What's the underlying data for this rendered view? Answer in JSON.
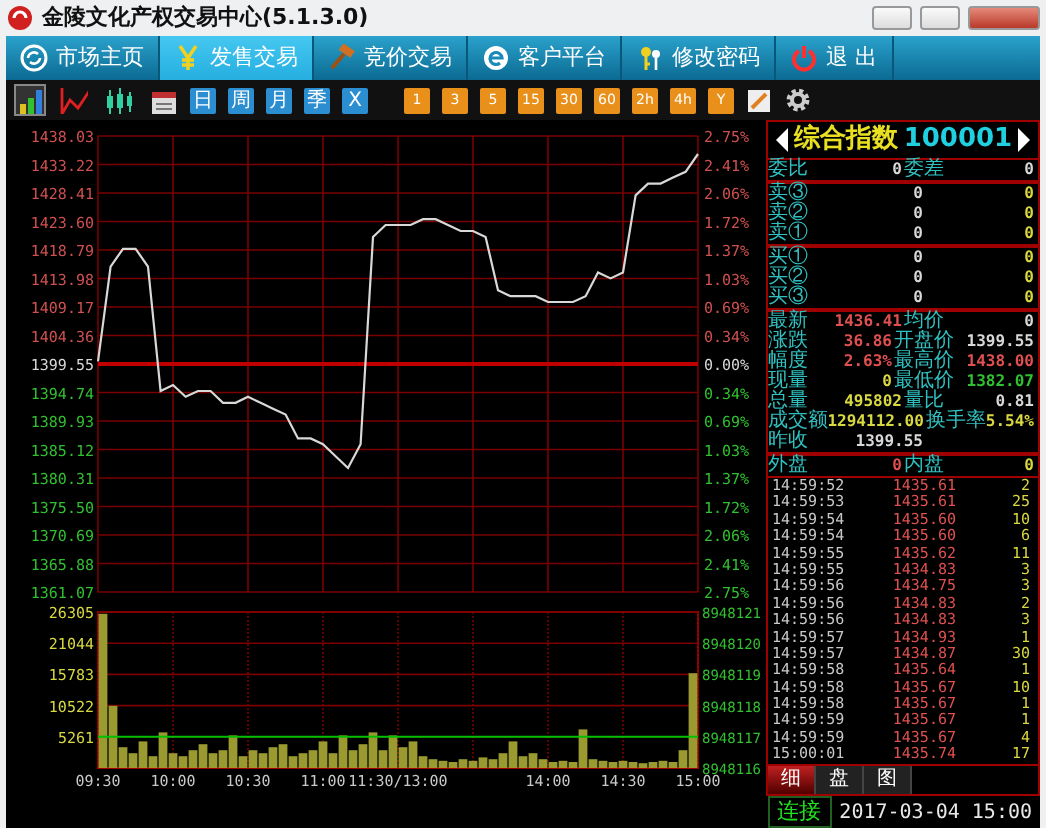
{
  "window": {
    "title": "金陵文化产权交易中心(5.1.3.0)"
  },
  "menu": [
    {
      "label": "市场主页",
      "selected": false
    },
    {
      "label": "发售交易",
      "selected": true
    },
    {
      "label": "竞价交易",
      "selected": false
    },
    {
      "label": "客户平台",
      "selected": false
    },
    {
      "label": "修改密码",
      "selected": false
    },
    {
      "label": "退 出",
      "selected": false
    }
  ],
  "toolbar": {
    "chart_tools": [
      {
        "selected": true
      },
      {
        "selected": false
      },
      {
        "selected": false
      },
      {
        "selected": false
      }
    ],
    "period_buttons": [
      {
        "label": "日"
      },
      {
        "label": "周"
      },
      {
        "label": "月"
      },
      {
        "label": "季"
      },
      {
        "label": "X"
      }
    ],
    "minute_buttons": [
      {
        "label": "1"
      },
      {
        "label": "3"
      },
      {
        "label": "5"
      },
      {
        "label": "15"
      },
      {
        "label": "30"
      },
      {
        "label": "60"
      },
      {
        "label": "2h"
      },
      {
        "label": "4h"
      },
      {
        "label": "Y"
      }
    ]
  },
  "price_chart": {
    "chart_data": {
      "type": "line",
      "grid": true,
      "ylim": [
        1361.07,
        1438.03
      ],
      "yticks": [
        {
          "value": 1438.03,
          "label": "1438.03"
        },
        {
          "value": 1433.22,
          "label": "1433.22"
        },
        {
          "value": 1428.41,
          "label": "1428.41"
        },
        {
          "value": 1423.6,
          "label": "1423.60"
        },
        {
          "value": 1418.79,
          "label": "1418.79"
        },
        {
          "value": 1413.98,
          "label": "1413.98"
        },
        {
          "value": 1409.17,
          "label": "1409.17"
        },
        {
          "value": 1404.36,
          "label": "1404.36"
        },
        {
          "value": 1399.55,
          "label": "1399.55"
        },
        {
          "value": 1394.74,
          "label": "1394.74"
        },
        {
          "value": 1389.93,
          "label": "1389.93"
        },
        {
          "value": 1385.12,
          "label": "1385.12"
        },
        {
          "value": 1380.31,
          "label": "1380.31"
        },
        {
          "value": 1375.5,
          "label": "1375.50"
        },
        {
          "value": 1370.69,
          "label": "1370.69"
        },
        {
          "value": 1365.88,
          "label": "1365.88"
        },
        {
          "value": 1361.07,
          "label": "1361.07"
        }
      ],
      "ref_lines": [
        {
          "axis": "y",
          "value": 1399.55,
          "color": "#c00000"
        }
      ],
      "categories": [
        null,
        null,
        null,
        null,
        null,
        null,
        null,
        null,
        null,
        null,
        null,
        null,
        null,
        null,
        null,
        null,
        null,
        null,
        null,
        null,
        null,
        null,
        null,
        null,
        null,
        null,
        null,
        null,
        null,
        null,
        null,
        null,
        null,
        null,
        null,
        null,
        null,
        null,
        null,
        null,
        null,
        null,
        null,
        null,
        null,
        null,
        null,
        null,
        null
      ],
      "series": [
        {
          "color": "#d8d8d8",
          "values": [
            1400,
            1416,
            1419,
            1419,
            1416,
            1395,
            1396,
            1394,
            1395,
            1395,
            1393,
            1393,
            1394,
            1393,
            1392,
            1391,
            1387,
            1387,
            1386,
            1384,
            1382,
            1386,
            1421,
            1423,
            1423,
            1423,
            1424,
            1424,
            1423,
            1422,
            1422,
            1421,
            1412,
            1411,
            1411,
            1411,
            1410,
            1410,
            1410,
            1411,
            1415,
            1414,
            1415,
            1428,
            1430,
            1430,
            1431,
            1432,
            1435
          ]
        }
      ]
    },
    "right_labels": [
      "2.75%",
      "2.41%",
      "2.06%",
      "1.72%",
      "1.37%",
      "1.03%",
      "0.69%",
      "0.34%",
      "0.00%",
      "0.34%",
      "0.69%",
      "1.03%",
      "1.37%",
      "1.72%",
      "2.06%",
      "2.41%",
      "2.75%"
    ]
  },
  "volume_chart": {
    "chart_data": {
      "type": "bar",
      "grid": true,
      "ylim": [
        0,
        26305
      ],
      "yticks": [
        {
          "value": 26305,
          "label": "26305"
        },
        {
          "value": 21044,
          "label": "21044"
        },
        {
          "value": 15783,
          "label": "15783"
        },
        {
          "value": 10522,
          "label": "10522"
        },
        {
          "value": 5261,
          "label": "5261"
        }
      ],
      "ref_lines": [
        {
          "axis": "y",
          "value": 5261,
          "color": "#00c000"
        }
      ],
      "categories": [
        null,
        null,
        null,
        null,
        null,
        null,
        null,
        null,
        null,
        null,
        null,
        null,
        null,
        null,
        null,
        null,
        null,
        null,
        null,
        null,
        null,
        null,
        null,
        null,
        null,
        null,
        null,
        null,
        null,
        null,
        null,
        null,
        null,
        null,
        null,
        null,
        null,
        null,
        null,
        null,
        null,
        null,
        null,
        null,
        null,
        null,
        null,
        null,
        null,
        null,
        null,
        null,
        null,
        null,
        null,
        null,
        null,
        null,
        null,
        null
      ],
      "series": [
        {
          "color": "#9a9a30",
          "values": [
            26000,
            10500,
            3500,
            2500,
            4500,
            2000,
            6000,
            2500,
            2000,
            3000,
            4000,
            2500,
            3000,
            5500,
            2000,
            3000,
            2500,
            3500,
            4000,
            2000,
            2500,
            3000,
            4500,
            2500,
            5500,
            3000,
            4000,
            6000,
            3000,
            5500,
            3500,
            4500,
            2000,
            1500,
            1200,
            1000,
            1500,
            1200,
            1800,
            1500,
            2500,
            4500,
            2000,
            2500,
            1500,
            1000,
            1200,
            1000,
            6500,
            1500,
            1200,
            1000,
            1200,
            1000,
            800,
            1000,
            1200,
            1000,
            3000,
            16000
          ]
        }
      ]
    },
    "right_labels": [
      "8948121",
      "8948120",
      "8948119",
      "8948118",
      "8948117",
      "8948116"
    ],
    "time_labels": [
      "09:30",
      "10:00",
      "10:30",
      "11:00",
      "11:30/13:00",
      "14:00",
      "14:30",
      "15:00"
    ]
  },
  "quote": {
    "name": "综合指数",
    "code": "100001",
    "blocks": [
      [
        {
          "cells": [
            {
              "label": "委比",
              "value": "0",
              "color": "#d8d8d8"
            },
            {
              "label": "委差",
              "value": "0",
              "color": "#d8d8d8"
            }
          ]
        }
      ],
      [
        {
          "cells": [
            {
              "label": "卖③",
              "value": "0",
              "color": "#d8d8d8"
            },
            {
              "value": "0",
              "color": "#d8d840"
            }
          ]
        },
        {
          "cells": [
            {
              "label": "卖②",
              "value": "0",
              "color": "#d8d8d8"
            },
            {
              "value": "0",
              "color": "#d8d840"
            }
          ]
        },
        {
          "cells": [
            {
              "label": "卖①",
              "value": "0",
              "color": "#d8d8d8"
            },
            {
              "value": "0",
              "color": "#d8d840"
            }
          ]
        }
      ],
      [
        {
          "cells": [
            {
              "label": "买①",
              "value": "0",
              "color": "#d8d8d8"
            },
            {
              "value": "0",
              "color": "#d8d840"
            }
          ]
        },
        {
          "cells": [
            {
              "label": "买②",
              "value": "0",
              "color": "#d8d8d8"
            },
            {
              "value": "0",
              "color": "#d8d840"
            }
          ]
        },
        {
          "cells": [
            {
              "label": "买③",
              "value": "0",
              "color": "#d8d8d8"
            },
            {
              "value": "0",
              "color": "#d8d840"
            }
          ]
        }
      ],
      [
        {
          "cells": [
            {
              "label": "最新",
              "value": "1436.41",
              "color": "#e05050"
            },
            {
              "label": "均价",
              "value": "0",
              "color": "#d8d8d8"
            }
          ]
        },
        {
          "cells": [
            {
              "label": "涨跌",
              "value": "36.86",
              "color": "#e05050"
            },
            {
              "label": "开盘价",
              "value": "1399.55",
              "color": "#d8d8d8"
            }
          ]
        },
        {
          "cells": [
            {
              "label": "幅度",
              "value": "2.63%",
              "color": "#e05050"
            },
            {
              "label": "最高价",
              "value": "1438.00",
              "color": "#e05050"
            }
          ]
        },
        {
          "cells": [
            {
              "label": "现量",
              "value": "0",
              "color": "#d8d840"
            },
            {
              "label": "最低价",
              "value": "1382.07",
              "color": "#30c030"
            }
          ]
        },
        {
          "cells": [
            {
              "label": "总量",
              "value": "495802",
              "color": "#d8d840"
            },
            {
              "label": "量比",
              "value": "0.81",
              "color": "#d8d8d8"
            }
          ]
        },
        {
          "cells": [
            {
              "label": "成交额",
              "value": "1294112.00",
              "color": "#d8d840"
            },
            {
              "label": "换手率",
              "value": "5.54%",
              "color": "#d8d840"
            }
          ]
        },
        {
          "cells": [
            {
              "label": "昨收",
              "value": "1399.55",
              "color": "#d8d8d8"
            }
          ]
        }
      ],
      [
        {
          "cells": [
            {
              "label": "外盘",
              "value": "0",
              "color": "#e05050"
            },
            {
              "label": "内盘",
              "value": "0",
              "color": "#d8d840"
            }
          ]
        }
      ]
    ]
  },
  "trades": [
    {
      "time": "14:59:52",
      "price": "1435.61",
      "volume": "2"
    },
    {
      "time": "14:59:53",
      "price": "1435.61",
      "volume": "25"
    },
    {
      "time": "14:59:54",
      "price": "1435.60",
      "volume": "10"
    },
    {
      "time": "14:59:54",
      "price": "1435.60",
      "volume": "6"
    },
    {
      "time": "14:59:55",
      "price": "1435.62",
      "volume": "11"
    },
    {
      "time": "14:59:55",
      "price": "1434.83",
      "volume": "3"
    },
    {
      "time": "14:59:56",
      "price": "1434.75",
      "volume": "3"
    },
    {
      "time": "14:59:56",
      "price": "1434.83",
      "volume": "2"
    },
    {
      "time": "14:59:56",
      "price": "1434.83",
      "volume": "3"
    },
    {
      "time": "14:59:57",
      "price": "1434.93",
      "volume": "1"
    },
    {
      "time": "14:59:57",
      "price": "1434.87",
      "volume": "30"
    },
    {
      "time": "14:59:58",
      "price": "1435.64",
      "volume": "1"
    },
    {
      "time": "14:59:58",
      "price": "1435.67",
      "volume": "10"
    },
    {
      "time": "14:59:58",
      "price": "1435.67",
      "volume": "1"
    },
    {
      "time": "14:59:59",
      "price": "1435.67",
      "volume": "1"
    },
    {
      "time": "14:59:59",
      "price": "1435.67",
      "volume": "4"
    },
    {
      "time": "15:00:01",
      "price": "1435.74",
      "volume": "17"
    }
  ],
  "panel_tabs": [
    {
      "label": "细",
      "selected": true
    },
    {
      "label": "盘",
      "selected": false
    },
    {
      "label": "图",
      "selected": false
    }
  ],
  "status_bar": {
    "connection": "连接",
    "datetime": "2017-03-04 15:00"
  }
}
